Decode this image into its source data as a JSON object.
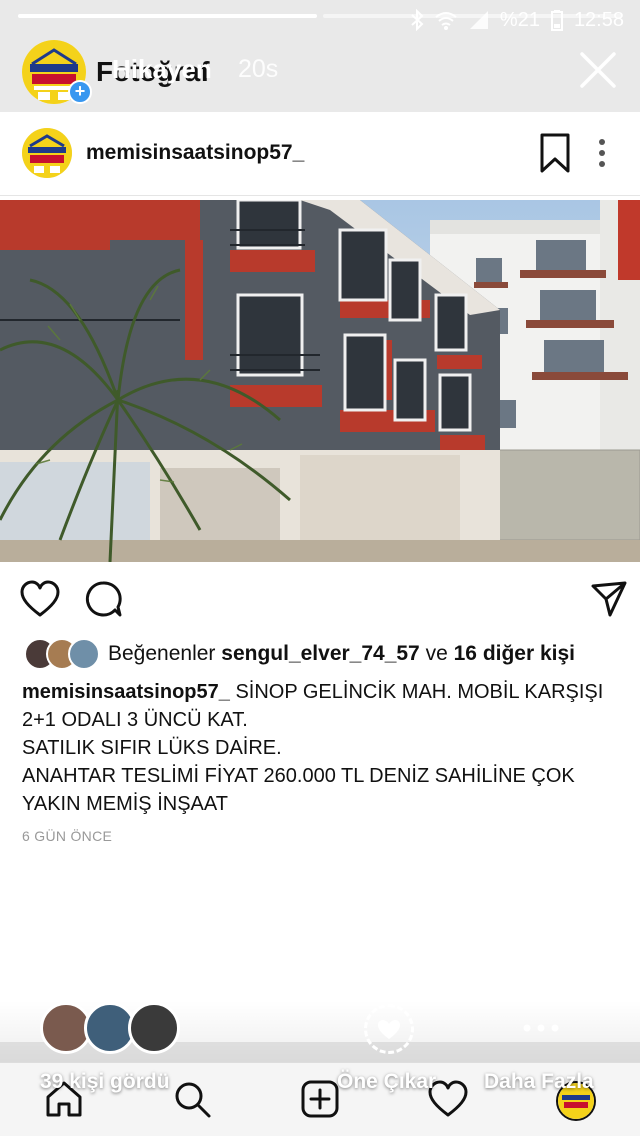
{
  "status_bar": {
    "battery": "%21",
    "time": "12:58"
  },
  "story": {
    "progress": [
      1.0,
      0.0
    ],
    "title_back": "Fotoğraf",
    "title": "Hikayen",
    "elapsed": "20s",
    "avatar_text": "MEMİŞ İNŞAAT"
  },
  "post": {
    "username": "memisinsaatsinop57_",
    "likes_prefix": "Beğenenler",
    "likes_user": "sengul_elver_74_57",
    "likes_and": "ve",
    "likes_others": "16 diğer kişi",
    "caption_user": "memisinsaatsinop57_",
    "caption_lines": [
      "SİNOP GELİNCİK MAH. MOBİL KARŞIŞI",
      "2+1 ODALI 3 ÜNCÜ KAT.",
      "SATILIK SIFIR LÜKS DAİRE.",
      "ANAHTAR TESLİMİ FİYAT 260.000 TL DENİZ SAHİLİNE ÇOK",
      "YAKIN MEMİŞ İNŞAAT"
    ],
    "date": "6 GÜN ÖNCE"
  },
  "footer": {
    "viewers_label": "39 kişi gördü",
    "highlight_label": "Öne Çıkar",
    "more_label": "Daha Fazla"
  },
  "colors": {
    "accent_blue": "#3897f0",
    "building_red": "#b83a2c",
    "building_gray": "#545a62"
  }
}
